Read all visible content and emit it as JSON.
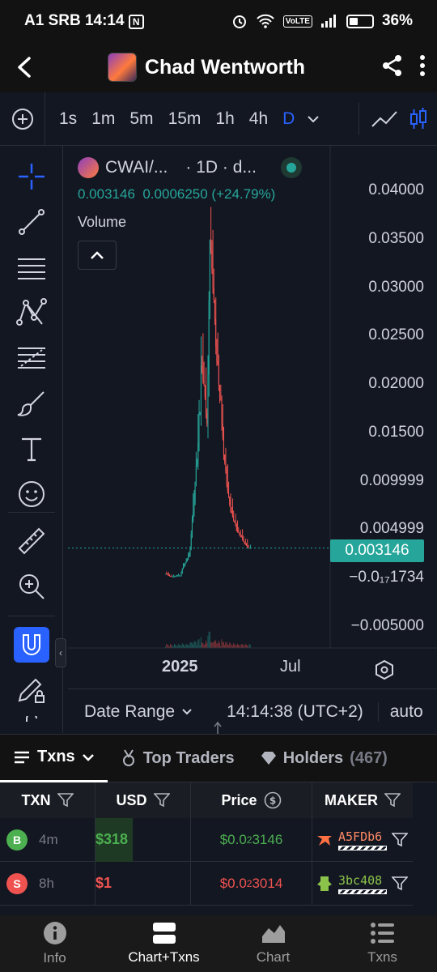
{
  "status_bar": {
    "carrier": "A1 SRB",
    "time": "14:14",
    "nfc": "N",
    "volte": "VoLTE",
    "battery": "36%"
  },
  "header": {
    "back_icon": "back-arrow-icon",
    "title": "Chad Wentworth",
    "share_icon": "share-icon",
    "more_icon": "more-vertical-icon"
  },
  "timeframes": {
    "items": [
      "1s",
      "1m",
      "5m",
      "15m",
      "1h",
      "4h",
      "D"
    ],
    "active": "D",
    "chevron": "chevron-down-icon",
    "active_color": "#2962ff"
  },
  "chart_legend": {
    "symbol": "CWAI/...",
    "interval": "· 1D · d...",
    "ohlc": "0.003146  0.0006250 (+24.79%)",
    "volume_label": "Volume"
  },
  "chart_data": {
    "type": "candlestick",
    "title": "",
    "price_axis_ticks": [
      "0.04000",
      "0.03500",
      "0.03000",
      "0.02500",
      "0.02000",
      "0.01500",
      "0.009999",
      "0.004999",
      "0.003146",
      "−0.0₁₇1734",
      "−0.005000"
    ],
    "price_axis_values": [
      0.04,
      0.035,
      0.03,
      0.025,
      0.02,
      0.015,
      0.009999,
      0.004999,
      0.003146,
      0,
      -0.005
    ],
    "time_axis_ticks": [
      "2025",
      "Jul"
    ],
    "current_price": 0.003146,
    "current_price_label": "0.003146",
    "ylim": [
      -0.005,
      0.04
    ],
    "series": [
      {
        "name": "",
        "close_path": [
          0.0005,
          0.0003,
          0.0002,
          0.0002,
          0.0003,
          0.0003,
          0.0012,
          0.0018,
          0.0025,
          0.006,
          0.01,
          0.014,
          0.022,
          0.02,
          0.016,
          0.035,
          0.03,
          0.024,
          0.02,
          0.016,
          0.012,
          0.009,
          0.007,
          0.006,
          0.005,
          0.0045,
          0.004,
          0.0035,
          0.003146
        ],
        "high_path": [
          0.0008,
          0.0006,
          0.0004,
          0.0004,
          0.0005,
          0.0005,
          0.0016,
          0.0022,
          0.003,
          0.008,
          0.012,
          0.017,
          0.026,
          0.024,
          0.018,
          0.0395,
          0.034,
          0.027,
          0.022,
          0.018,
          0.014,
          0.011,
          0.0085,
          0.0072,
          0.006,
          0.0052,
          0.0048,
          0.0042,
          0.0036
        ]
      }
    ],
    "up_color": "#26a69a",
    "down_color": "#ef5350",
    "grid": false
  },
  "range_bar": {
    "date_range": "Date Range",
    "time": "14:14:38 (UTC+2)",
    "scale": "auto"
  },
  "tabs": [
    {
      "label": "Txns",
      "icon": "list-icon",
      "active": true
    },
    {
      "label": "Top Traders",
      "icon": "medal-icon",
      "active": false
    },
    {
      "label": "Holders",
      "count": "(467)",
      "icon": "diamond-icon",
      "active": false
    }
  ],
  "table": {
    "headers": [
      "TXN",
      "USD",
      "Price",
      "MAKER"
    ],
    "rows": [
      {
        "type": "B",
        "age": "4m",
        "usd": "$318",
        "price_prefix": "$0.0",
        "price_sub": "2",
        "price_rest": "3146",
        "maker": "A5FDb6",
        "side": "buy"
      },
      {
        "type": "S",
        "age": "8h",
        "usd": "$1",
        "price_prefix": "$0.0",
        "price_sub": "2",
        "price_rest": "3014",
        "maker": "3bc408",
        "side": "sell"
      }
    ]
  },
  "bottom_nav": [
    {
      "label": "Info",
      "icon": "info-icon",
      "active": false
    },
    {
      "label": "Chart+Txns",
      "icon": "split-view-icon",
      "active": true
    },
    {
      "label": "Chart",
      "icon": "area-chart-icon",
      "active": false
    },
    {
      "label": "Txns",
      "icon": "list-icon",
      "active": false
    }
  ]
}
